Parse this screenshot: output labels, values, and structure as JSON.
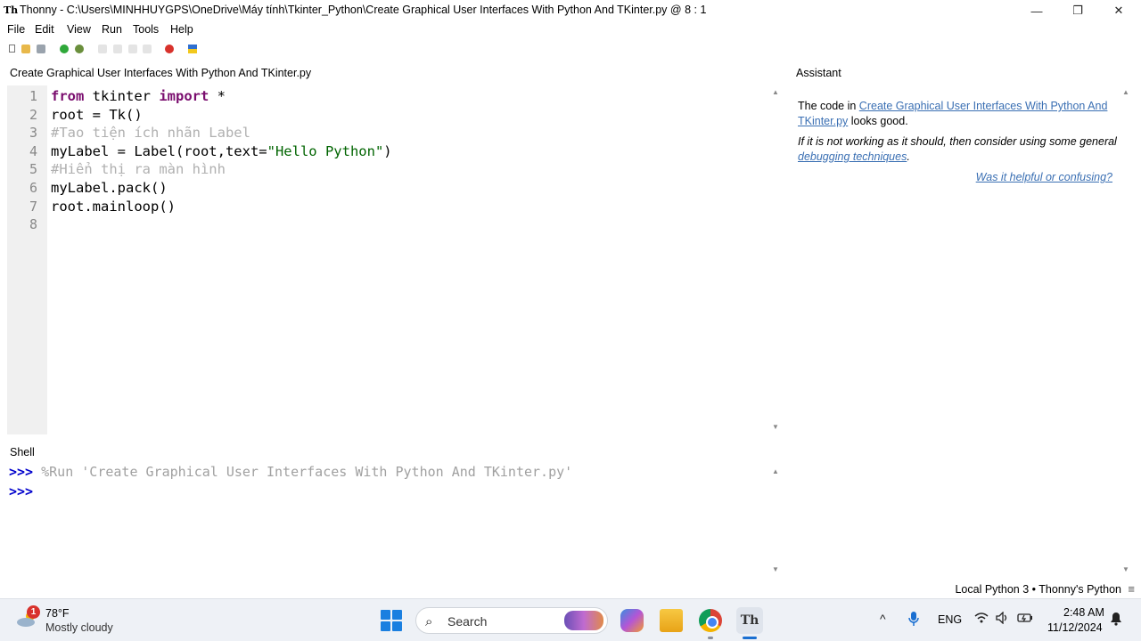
{
  "window": {
    "title": "Thonny  -  C:\\Users\\MINHHUYGPS\\OneDrive\\Máy tính\\Tkinter_Python\\Create Graphical User Interfaces With Python And TKinter.py  @  8 : 1",
    "min": "—",
    "max": "❐",
    "close": "✕",
    "logo": "Th"
  },
  "menu": [
    "File",
    "Edit",
    "View",
    "Run",
    "Tools",
    "Help"
  ],
  "editor": {
    "tab_title": "Create Graphical User Interfaces With Python And TKinter.py",
    "line_numbers": [
      "1",
      "2",
      "3",
      "4",
      "5",
      "6",
      "7",
      "8"
    ]
  },
  "code": {
    "l1_kw1": "from",
    "l1_mid": " tkinter ",
    "l1_kw2": "import",
    "l1_end": " *",
    "l2": "root = Tk()",
    "l3": "#Tao tiện ích nhãn Label",
    "l4_pre": "myLabel = Label(root,text=",
    "l4_str": "\"Hello Python\"",
    "l4_post": ")",
    "l5": "#Hiển thị ra màn hình",
    "l6": "myLabel.pack()",
    "l7": "root.mainloop()"
  },
  "shell": {
    "label": "Shell",
    "prompt": ">>>",
    "command": " %Run 'Create Graphical User Interfaces With Python And TKinter.py'"
  },
  "assistant": {
    "title": "Assistant",
    "p1_pre": "The code in ",
    "p1_link": "Create Graphical User Interfaces With Python And TKinter.py",
    "p1_post": " looks good.",
    "p2_pre": "If it is not working as it should, then consider using some general ",
    "p2_link": "debugging techniques",
    "p2_post": ".",
    "feedback": "Was it helpful or confusing?"
  },
  "status": {
    "text": "Local Python 3  •  Thonny's Python",
    "menu_icon": "≡"
  },
  "taskbar": {
    "weather_badge": "1",
    "weather_temp": "78°F",
    "weather_cond": "Mostly cloudy",
    "search_placeholder": "Search",
    "search_icon": "⌕",
    "thonny_label": "Th",
    "tray_chevron": "^",
    "tray_lang": "ENG",
    "clock_time": "2:48 AM",
    "clock_date": "11/12/2024"
  }
}
